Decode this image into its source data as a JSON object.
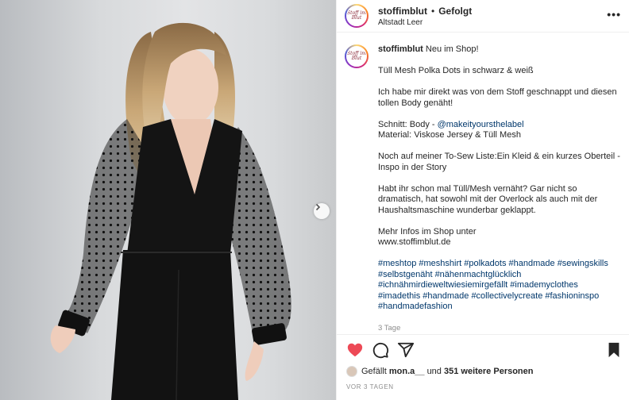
{
  "post": {
    "username": "stoffimblut",
    "separator": "•",
    "follow_status": "Gefolgt",
    "location": "Altstadt Leer",
    "more_label": "•••",
    "avatar_logo": "Stoff im Blut"
  },
  "caption": {
    "username": "stoffimblut",
    "line1": "Neu im Shop!",
    "p2": "Tüll Mesh Polka Dots in schwarz & weiß",
    "p3": "Ich habe mir direkt was von dem Stoff geschnappt und diesen tollen Body genäht!",
    "p4_prefix": "Schnitt: Body - ",
    "p4_mention": "@makeityoursthelabel",
    "p4_line2": "Material: Viskose Jersey & Tüll Mesh",
    "p5": "Noch auf meiner To-Sew Liste:Ein Kleid & ein kurzes Oberteil - Inspo in der Story",
    "p6": "Habt ihr schon mal Tüll/Mesh vernäht? Gar nicht so dramatisch, hat sowohl mit der Overlock als auch mit der Haushaltsmaschine wunderbar geklappt.",
    "p7_line1": "Mehr Infos im Shop unter",
    "p7_line2": "www.stoffimblut.de",
    "hashtags": [
      "#meshtop",
      "#meshshirt",
      "#polkadots",
      "#handmade",
      "#sewingskills",
      "#selbstgenäht",
      "#nähenmachtglücklich",
      "#ichnähmirdieweltwiesiemirgefällt",
      "#imademyclothes",
      "#imadethis",
      "#handmade",
      "#collectivelycreate",
      "#fashioninspo",
      "#handmadefashion"
    ],
    "timestamp": "3 Tage"
  },
  "likes": {
    "prefix": "Gefällt",
    "user": "mon.a__",
    "middle": "und",
    "others": "351 weitere Personen"
  },
  "ago": "VOR 3 TAGEN",
  "colors": {
    "heart": "#ed4956",
    "link": "#00376b",
    "muted": "#8e8e8e"
  }
}
